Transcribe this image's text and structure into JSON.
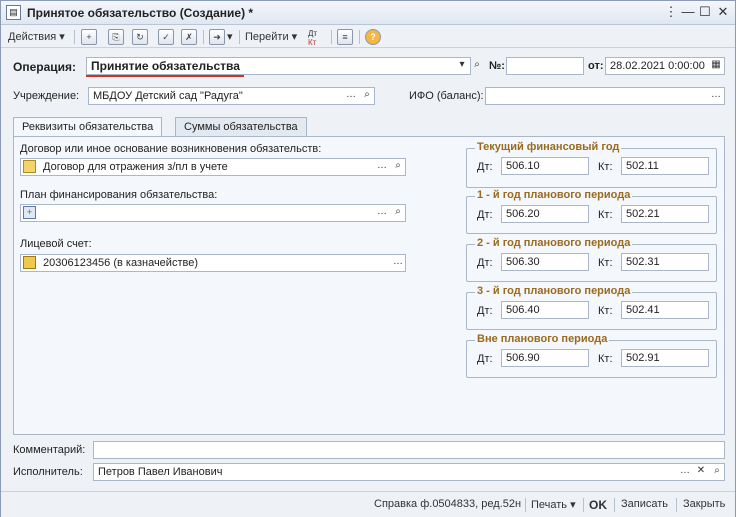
{
  "window": {
    "title": "Принятое обязательство (Создание) *"
  },
  "toolbar": {
    "actions": "Действия",
    "goto": "Перейти",
    "dt_label": "Дт",
    "kt_label": "Кт"
  },
  "header": {
    "operation_label": "Операция:",
    "operation_value": "Принятие обязательства",
    "number_label": "№:",
    "number_value": "",
    "date_label": "от:",
    "date_value": "28.02.2021  0:00:00",
    "institution_label": "Учреждение:",
    "institution_value": "МБДОУ Детский сад \"Радуга\"",
    "ifo_label": "ИФО (баланс):",
    "ifo_value": ""
  },
  "tabs": [
    {
      "label": "Реквизиты обязательства"
    },
    {
      "label": "Суммы обязательства"
    }
  ],
  "left": {
    "contract_label": "Договор или иное основание возникновения обязательств:",
    "contract_value": "Договор для отражения з/пл в учете",
    "plan_label": "План финансирования обязательства:",
    "plan_value": "",
    "account_label": "Лицевой счет:",
    "account_value": "20306123456 (в казначействе)"
  },
  "groups": [
    {
      "title": "Текущий финансовый год",
      "dt_label": "Дт:",
      "dt": "506.10",
      "kt_label": "Кт:",
      "kt": "502.11"
    },
    {
      "title": "1 - й год планового периода",
      "dt_label": "Дт:",
      "dt": "506.20",
      "kt_label": "Кт:",
      "kt": "502.21"
    },
    {
      "title": "2 - й год планового периода",
      "dt_label": "Дт:",
      "dt": "506.30",
      "kt_label": "Кт:",
      "kt": "502.31"
    },
    {
      "title": "3 - й год планового периода",
      "dt_label": "Дт:",
      "dt": "506.40",
      "kt_label": "Кт:",
      "kt": "502.41"
    },
    {
      "title": "Вне планового периода",
      "dt_label": "Дт:",
      "dt": "506.90",
      "kt_label": "Кт:",
      "kt": "502.91"
    }
  ],
  "footer": {
    "comment_label": "Комментарий:",
    "comment_value": "",
    "executor_label": "Исполнитель:",
    "executor_value": "Петров Павел Иванович"
  },
  "bottom": {
    "report": "Справка ф.0504833, ред.52н",
    "print": "Печать",
    "ok": "OK",
    "save": "Записать",
    "close": "Закрыть"
  },
  "colors": {
    "accent": "#c0392b",
    "group_title": "#9a6a1f"
  }
}
